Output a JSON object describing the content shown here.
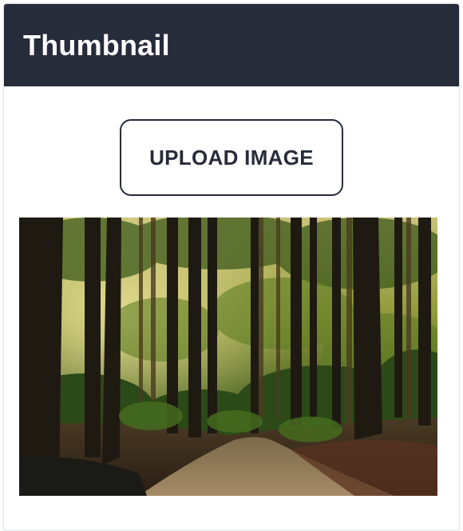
{
  "card": {
    "title": "Thumbnail"
  },
  "upload": {
    "label": "UPLOAD IMAGE"
  },
  "thumbnail": {
    "subject": "forest-path-photo"
  },
  "colors": {
    "header_bg": "#272c3b",
    "header_text": "#ffffff",
    "button_border": "#272c3b",
    "button_text": "#272c3b"
  }
}
